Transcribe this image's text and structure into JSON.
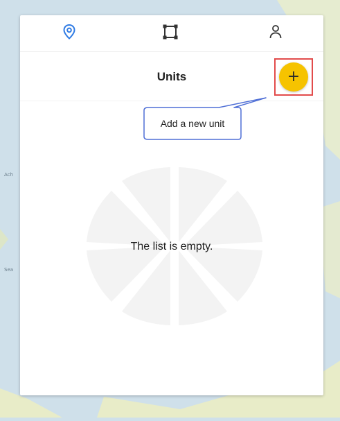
{
  "nav": {
    "location_icon": "location-pin-icon",
    "area_icon": "area-square-icon",
    "user_icon": "user-icon",
    "active_color": "#2f7be4"
  },
  "header": {
    "title": "Units",
    "add_label": "+",
    "add_color": "#f6c300",
    "highlight_color": "#e24b4b"
  },
  "tooltip": {
    "text": "Add a new unit",
    "border_color": "#4f6fd6"
  },
  "empty_state": {
    "message": "The list is empty."
  },
  "map": {
    "labels": [
      "Ach",
      "Sea"
    ]
  }
}
